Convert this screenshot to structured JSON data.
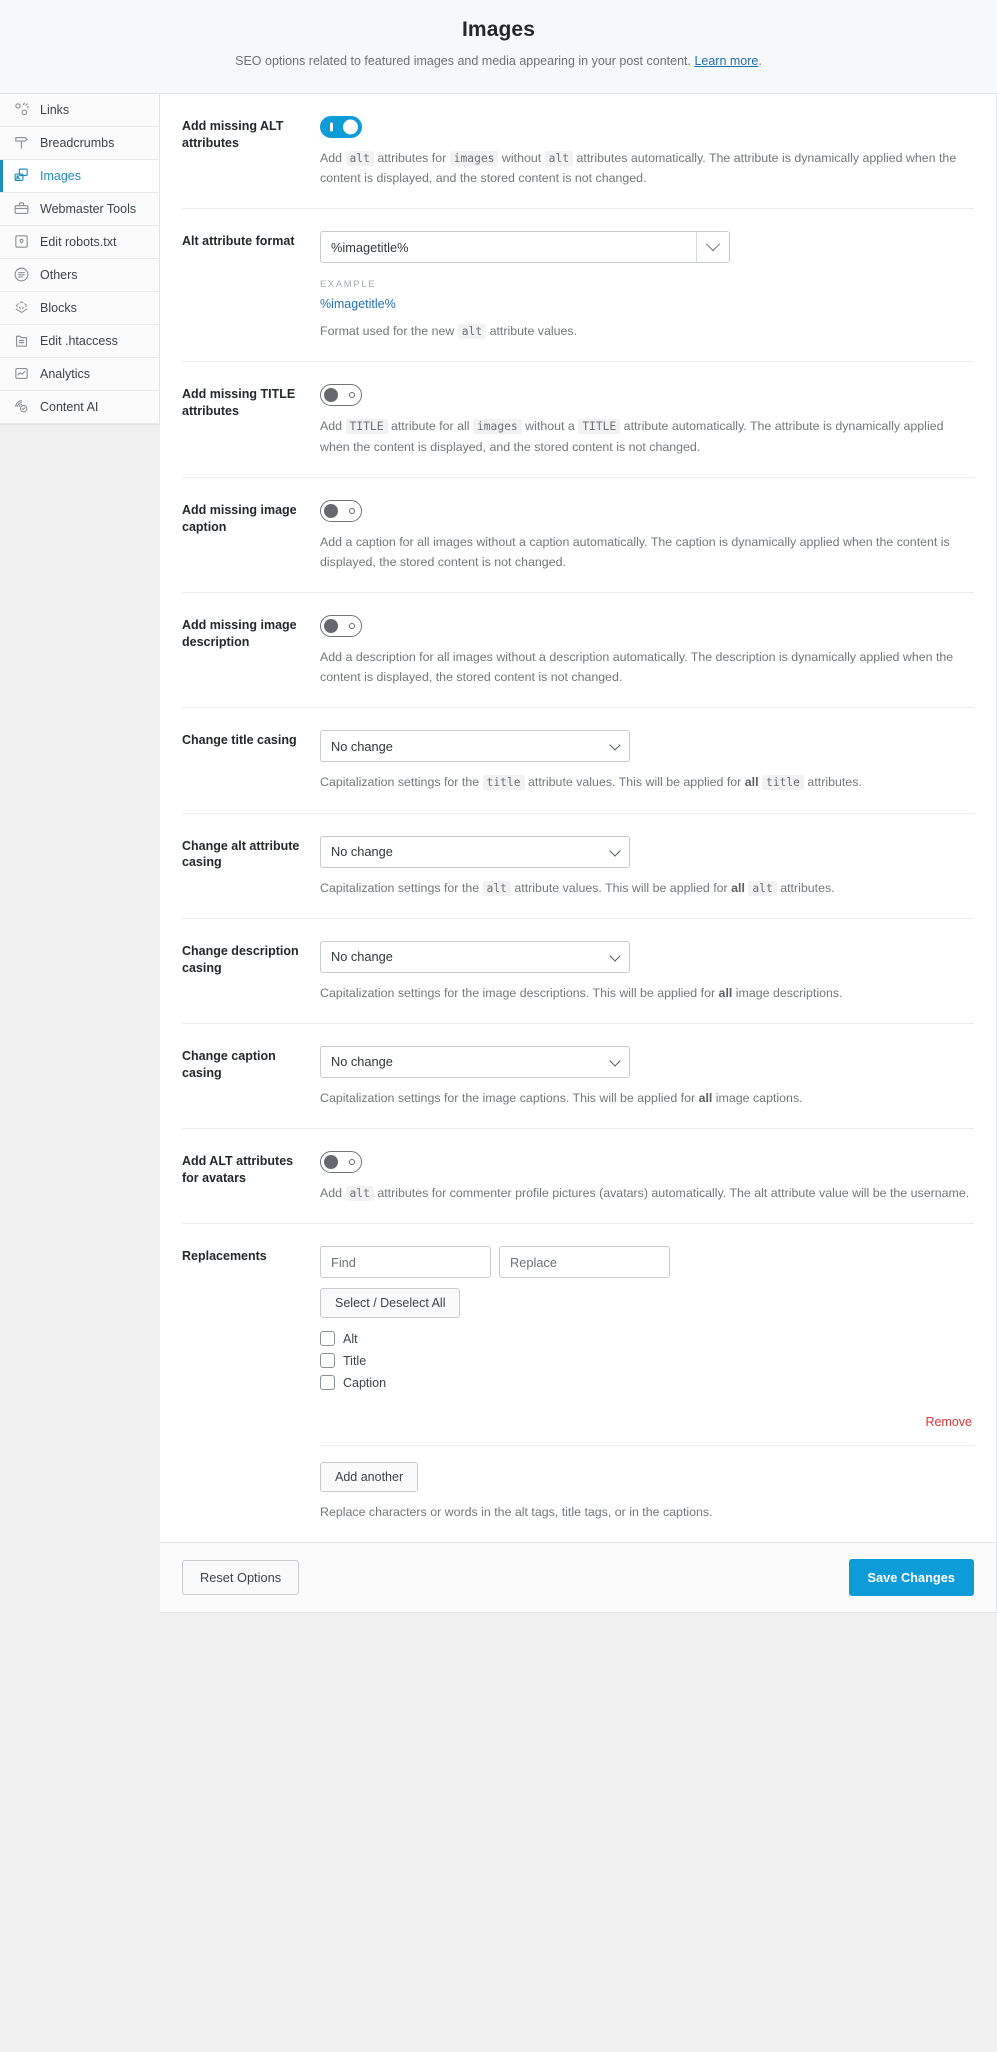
{
  "header": {
    "title": "Images",
    "subtitle_before": "SEO options related to featured images and media appearing in your post content.",
    "link_label": "Learn more",
    "subtitle_after": "."
  },
  "sidebar": {
    "items": [
      {
        "label": "Links",
        "icon": "links-icon",
        "active": false
      },
      {
        "label": "Breadcrumbs",
        "icon": "breadcrumbs-icon",
        "active": false
      },
      {
        "label": "Images",
        "icon": "images-icon",
        "active": true
      },
      {
        "label": "Webmaster Tools",
        "icon": "toolbox-icon",
        "active": false
      },
      {
        "label": "Edit robots.txt",
        "icon": "robots-file-icon",
        "active": false
      },
      {
        "label": "Others",
        "icon": "others-circle-icon",
        "active": false
      },
      {
        "label": "Blocks",
        "icon": "blocks-layers-icon",
        "active": false
      },
      {
        "label": "Edit .htaccess",
        "icon": "document-icon",
        "active": false
      },
      {
        "label": "Analytics",
        "icon": "analytics-chart-icon",
        "active": false
      },
      {
        "label": "Content AI",
        "icon": "content-ai-icon",
        "active": false
      }
    ]
  },
  "fields": {
    "add_missing_alt": {
      "label": "Add missing ALT attributes",
      "toggle_state": "on",
      "desc_parts": [
        "Add ",
        "alt",
        " attributes for ",
        "images",
        " without ",
        "alt",
        " attributes automatically. The attribute is dynamically applied when the content is displayed, and the stored content is not changed."
      ]
    },
    "alt_format": {
      "label": "Alt attribute format",
      "value": "%imagetitle%",
      "example_label": "EXAMPLE",
      "example_value": "%imagetitle%",
      "desc_before": "Format used for the new ",
      "desc_code": "alt",
      "desc_after": " attribute values."
    },
    "add_missing_title": {
      "label": "Add missing TITLE attributes",
      "toggle_state": "off",
      "desc_parts": [
        "Add ",
        "TITLE",
        " attribute for all ",
        "images",
        " without a ",
        "TITLE",
        " attribute automatically. The attribute is dynamically applied when the content is displayed, and the stored content is not changed."
      ]
    },
    "add_missing_caption": {
      "label": "Add missing image caption",
      "toggle_state": "off",
      "desc": "Add a caption for all images without a caption automatically. The caption is dynamically applied when the content is displayed, the stored content is not changed."
    },
    "add_missing_description": {
      "label": "Add missing image description",
      "toggle_state": "off",
      "desc": "Add a description for all images without a description automatically. The description is dynamically applied when the content is displayed, the stored content is not changed."
    },
    "title_casing": {
      "label": "Change title casing",
      "value": "No change",
      "desc_a": "Capitalization settings for the ",
      "desc_code1": "title",
      "desc_b": " attribute values. This will be applied for ",
      "desc_bold": "all",
      "desc_c": " ",
      "desc_code2": "title",
      "desc_d": " attributes."
    },
    "alt_casing": {
      "label": "Change alt attribute casing",
      "value": "No change",
      "desc_a": "Capitalization settings for the ",
      "desc_code1": "alt",
      "desc_b": " attribute values. This will be applied for ",
      "desc_bold": "all",
      "desc_c": " ",
      "desc_code2": "alt",
      "desc_d": " attributes."
    },
    "description_casing": {
      "label": "Change description casing",
      "value": "No change",
      "desc_a": "Capitalization settings for the image descriptions. This will be applied for ",
      "desc_bold": "all",
      "desc_b": " image descriptions."
    },
    "caption_casing": {
      "label": "Change caption casing",
      "value": "No change",
      "desc_a": "Capitalization settings for the image captions. This will be applied for ",
      "desc_bold": "all",
      "desc_b": " image captions."
    },
    "alt_avatars": {
      "label": "Add ALT attributes for avatars",
      "toggle_state": "off",
      "desc_a": "Add ",
      "desc_code": "alt",
      "desc_b": " attributes for commenter profile pictures (avatars) automatically. The alt attribute value will be the username."
    },
    "replacements": {
      "label": "Replacements",
      "find_placeholder": "Find",
      "replace_placeholder": "Replace",
      "find_value": "",
      "replace_value": "",
      "select_all_label": "Select / Deselect All",
      "checkboxes": [
        {
          "label": "Alt",
          "checked": false
        },
        {
          "label": "Title",
          "checked": false
        },
        {
          "label": "Caption",
          "checked": false
        }
      ],
      "remove_label": "Remove",
      "add_another_label": "Add another",
      "desc": "Replace characters or words in the alt tags, title tags, or in the captions."
    }
  },
  "footer": {
    "reset_label": "Reset Options",
    "save_label": "Save Changes"
  },
  "colors": {
    "accent": "#0d9cd8",
    "link": "#2271b1",
    "danger": "#d63638"
  }
}
